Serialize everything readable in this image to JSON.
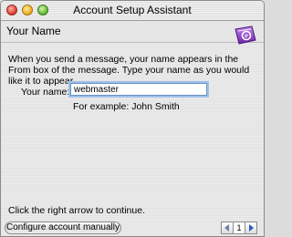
{
  "window": {
    "title": "Account Setup Assistant"
  },
  "page": {
    "heading": "Your Name",
    "intro": "When you send a message, your name appears in the From box of the message. Type your name as you would like it to appear.",
    "name_label": "Your name:",
    "name_value": "webmaster",
    "example": "For example: John Smith",
    "footer": "Click the right arrow to continue."
  },
  "buttons": {
    "configure_manually": "Configure account manually",
    "page_number": "1"
  },
  "icons": {
    "close": "close-button",
    "minimize": "minimize-button",
    "zoom": "zoom-button",
    "app": "entourage-icon",
    "prev": "arrow-left-icon",
    "next": "arrow-right-icon"
  },
  "colors": {
    "accent_purple": "#8a3ec8",
    "focus_blue": "#9ec1ec",
    "arrow_blue": "#2a58c4"
  }
}
